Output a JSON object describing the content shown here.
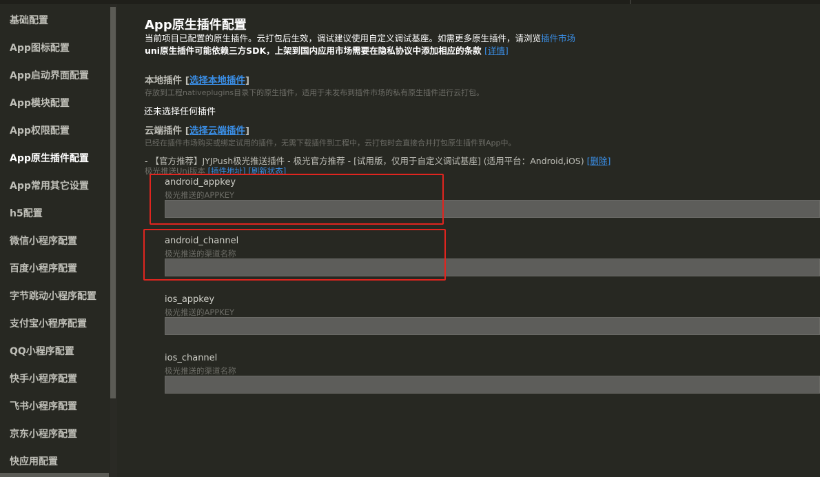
{
  "sidebar": {
    "items": [
      {
        "label": "基础配置",
        "active": false
      },
      {
        "label": "App图标配置",
        "active": false
      },
      {
        "label": "App启动界面配置",
        "active": false
      },
      {
        "label": "App模块配置",
        "active": false
      },
      {
        "label": "App权限配置",
        "active": false
      },
      {
        "label": "App原生插件配置",
        "active": true
      },
      {
        "label": "App常用其它设置",
        "active": false
      },
      {
        "label": "h5配置",
        "active": false
      },
      {
        "label": "微信小程序配置",
        "active": false
      },
      {
        "label": "百度小程序配置",
        "active": false
      },
      {
        "label": "字节跳动小程序配置",
        "active": false
      },
      {
        "label": "支付宝小程序配置",
        "active": false
      },
      {
        "label": "QQ小程序配置",
        "active": false
      },
      {
        "label": "快手小程序配置",
        "active": false
      },
      {
        "label": "飞书小程序配置",
        "active": false
      },
      {
        "label": "京东小程序配置",
        "active": false
      },
      {
        "label": "快应用配置",
        "active": false
      }
    ]
  },
  "main": {
    "title": "App原生插件配置",
    "desc1": "当前项目已配置的原生插件。云打包后生效，调试建议使用自定义调试基座。如需更多原生插件，请浏览",
    "desc1_link": "插件市场",
    "desc2": "uni原生插件可能依赖三方SDK，上架到国内应用市场需要在隐私协议中添加相应的条款",
    "desc2_link": "[详情]",
    "local": {
      "title": "本地插件",
      "bracket_open": "[",
      "link": "选择本地插件",
      "bracket_close": "]",
      "hint": "存放到工程nativeplugins目录下的原生插件，适用于未发布到插件市场的私有原生插件进行云打包。",
      "empty": "还未选择任何插件"
    },
    "cloud": {
      "title": "云端插件",
      "bracket_open": "[",
      "link": "选择云端插件",
      "bracket_close": "]",
      "hint": "已经在插件市场购买或绑定试用的插件，无需下载插件到工程中，云打包时会直接合并打包原生插件到App中。"
    },
    "plugin": {
      "line": "- 【官方推荐】JYJPush极光推送插件 - 极光官方推荐 - [试用版，仅用于自定义调试基座] (适用平台：Android,iOS)",
      "delete_link": "[删除]",
      "sub_text": "极光推送Uni版本",
      "sub_link1": "[插件地址]",
      "sub_link2": "[刷新状态]"
    },
    "fields": [
      {
        "label": "android_appkey",
        "hint": "极光推送的APPKEY",
        "value": "",
        "highlighted": true
      },
      {
        "label": "android_channel",
        "hint": "极光推送的渠道名称",
        "value": "",
        "highlighted": true
      },
      {
        "label": "ios_appkey",
        "hint": "极光推送的APPKEY",
        "value": "",
        "highlighted": false
      },
      {
        "label": "ios_channel",
        "hint": "极光推送的渠道名称",
        "value": "",
        "highlighted": false
      }
    ]
  },
  "colors": {
    "background": "#272822",
    "link": "#3a8ee6",
    "highlight": "#e0251f",
    "input_bg": "#5d5d5a"
  }
}
